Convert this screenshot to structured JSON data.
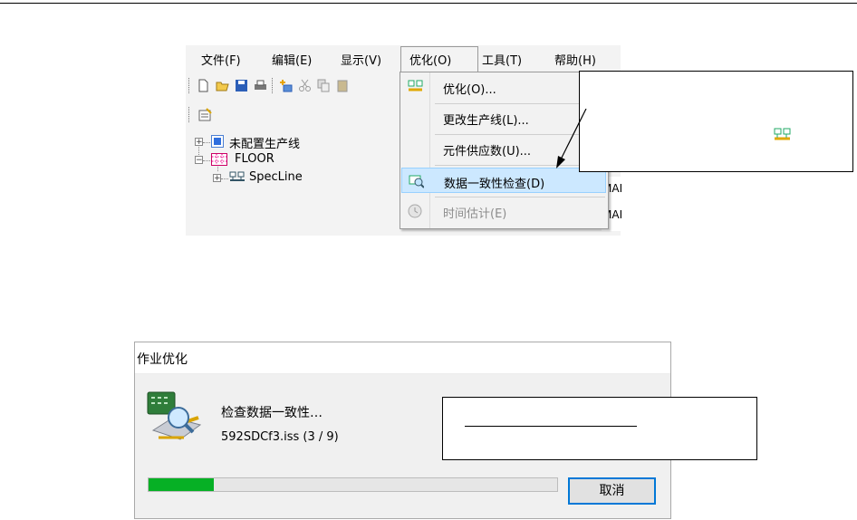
{
  "menubar": {
    "items": [
      "文件(F)",
      "编辑(E)",
      "显示(V)",
      "优化(O)",
      "工具(T)",
      "帮助(H)"
    ],
    "open_index": 3
  },
  "tree": {
    "items": [
      {
        "label": "未配置生产线",
        "icon": "unconfigured-line-icon"
      },
      {
        "label": "FLOOR",
        "icon": "floor-icon"
      },
      {
        "label": "SpecLine",
        "icon": "line-icon"
      }
    ]
  },
  "strip_partial": [
    "MAI",
    "MAI"
  ],
  "dropdown": {
    "items": [
      {
        "label": "优化(O)...",
        "icon": "optimize-icon",
        "enabled": true
      },
      {
        "label": "更改生产线(L)...",
        "icon": "",
        "enabled": true
      },
      {
        "label": "元件供应数(U)...",
        "icon": "",
        "enabled": true
      },
      {
        "label": "数据一致性检查(D)",
        "icon": "data-check-icon",
        "enabled": true,
        "highlighted": true
      },
      {
        "label": "时间估计(E)",
        "icon": "clock-icon",
        "enabled": false
      }
    ]
  },
  "dialog": {
    "title": "作业优化",
    "status": "检查数据一致性…",
    "file": "592SDCf3.iss  (3 / 9)",
    "progress": 0.16,
    "cancel_label": "取消"
  },
  "colors": {
    "highlight": "#cce8ff",
    "progress_fill": "#06b025",
    "button_border": "#0078d7"
  }
}
